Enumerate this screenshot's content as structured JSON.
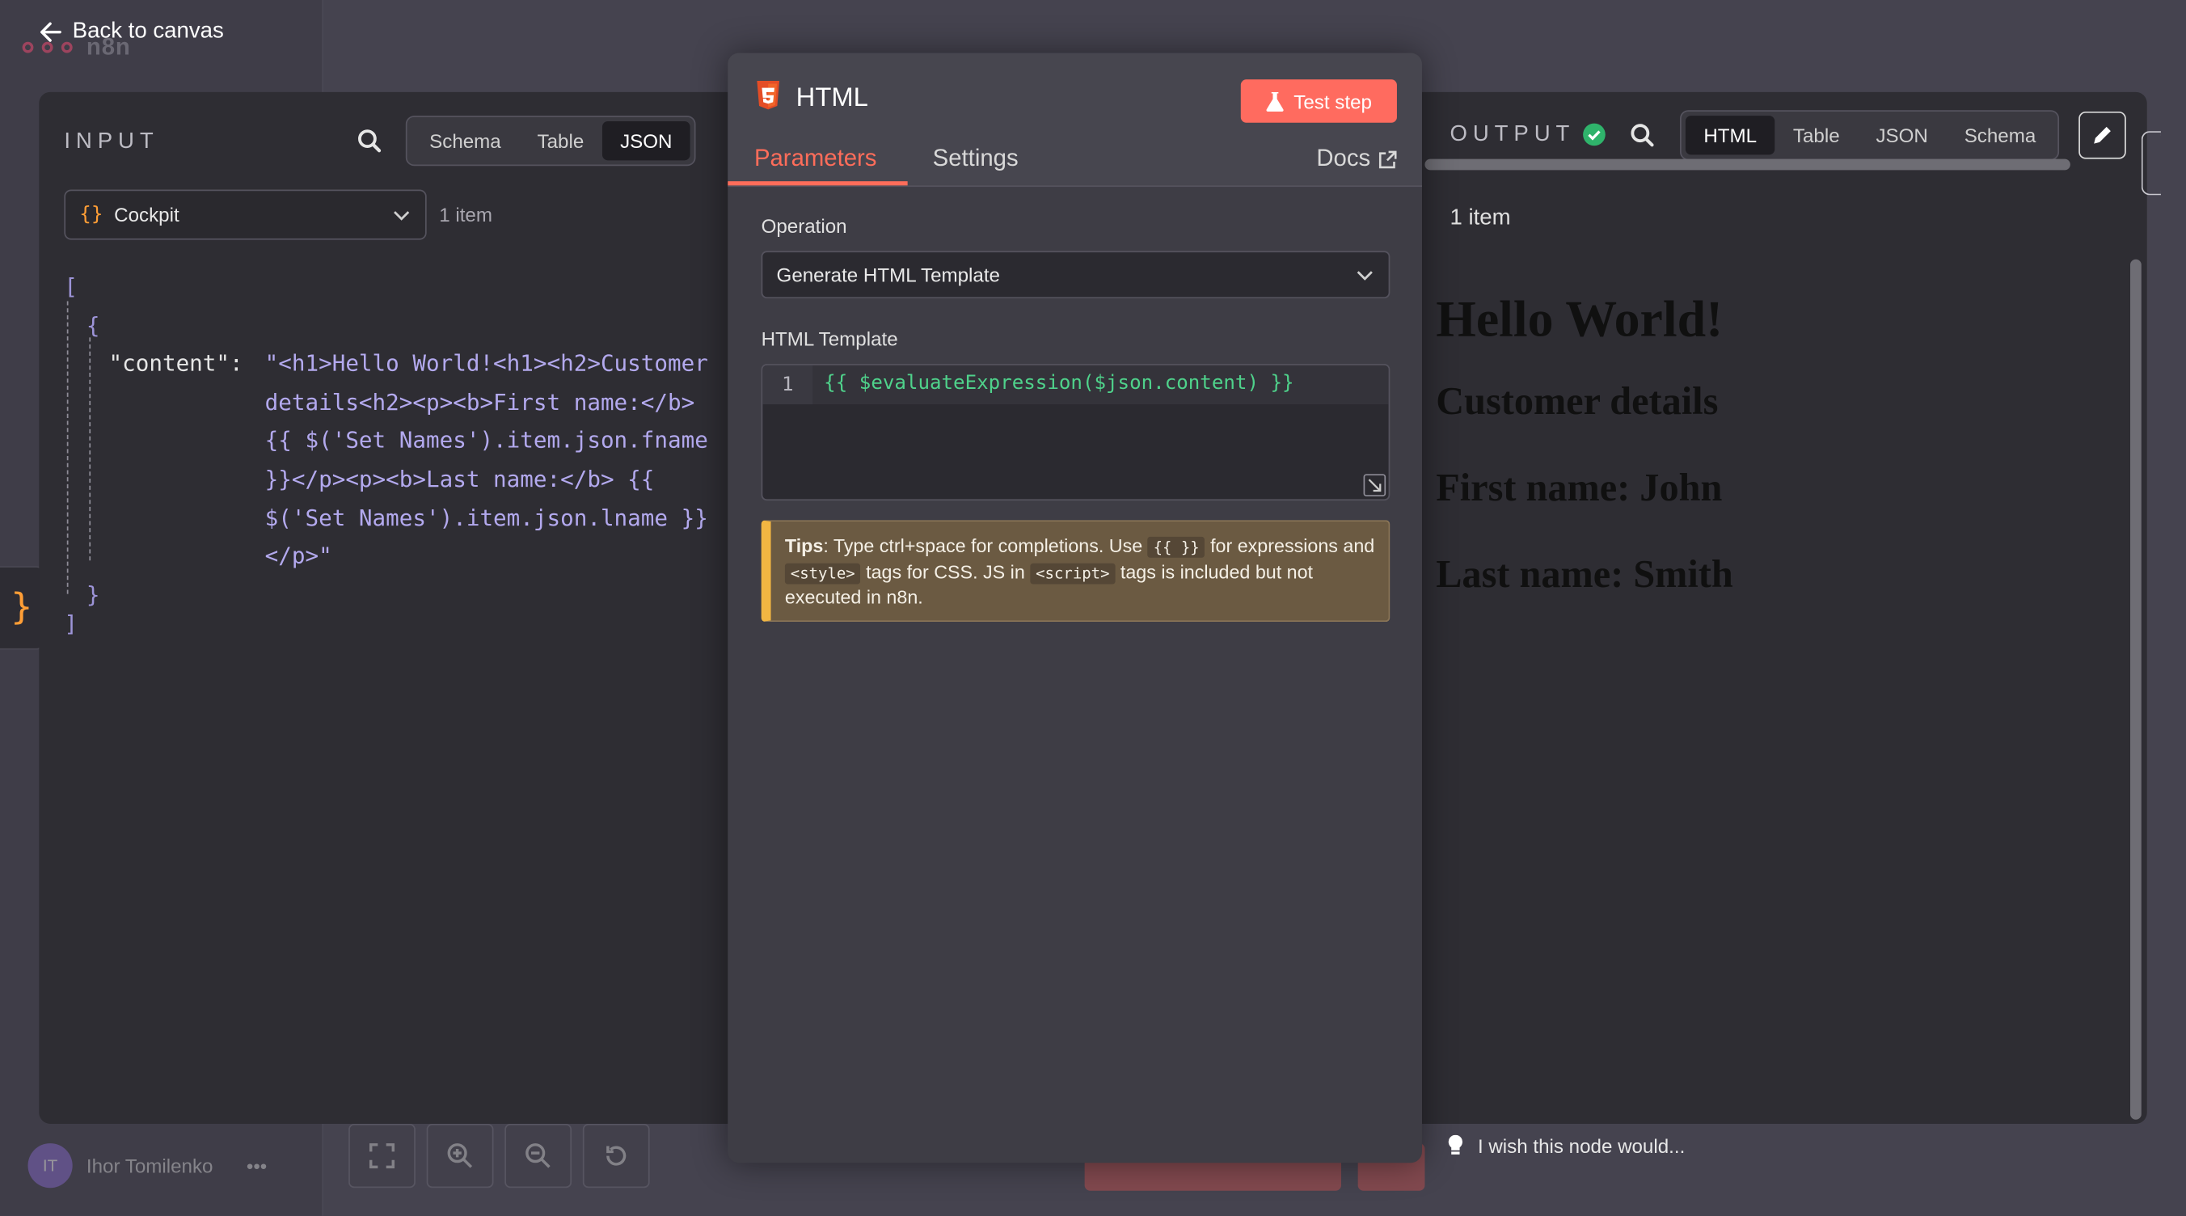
{
  "nav": {
    "back_label": "Back to canvas",
    "logo_text": "n8n"
  },
  "user": {
    "initials": "IT",
    "name": "Ihor Tomilenko",
    "more": "•••"
  },
  "input": {
    "title": "INPUT",
    "tabs": [
      "Schema",
      "Table",
      "JSON"
    ],
    "active_tab": "JSON",
    "node_select": "Cockpit",
    "item_count": "1 item",
    "json": {
      "open_bracket": "[",
      "open_brace": "{",
      "key": "\"content\":",
      "value_lines": [
        "\"<h1>Hello World!<h1><h2>Customer",
        "details<h2><p><b>First name:</b>",
        "{{ $('Set Names').item.json.fname",
        "}}</p><p><b>Last name:</b> {{",
        "$('Set Names').item.json.lname }}",
        "</p>\""
      ],
      "close_brace": "}",
      "close_bracket": "]"
    }
  },
  "params": {
    "title": "HTML",
    "test_button": "Test step",
    "tabs": {
      "parameters": "Parameters",
      "settings": "Settings",
      "docs": "Docs"
    },
    "operation_label": "Operation",
    "operation_value": "Generate HTML Template",
    "template_label": "HTML Template",
    "code_line_number": "1",
    "code_line": "{{ $evaluateExpression($json.content) }}",
    "tips": {
      "bold": "Tips",
      "t1": ": Type ctrl+space for completions. Use ",
      "c1": "{{ }}",
      "t2": " for expressions and ",
      "c2": "<style>",
      "t3": " tags for CSS. JS in ",
      "c3": "<script>",
      "t4": " tags is included but not executed in n8n."
    }
  },
  "output": {
    "title": "OUTPUT",
    "tabs": [
      "HTML",
      "Table",
      "JSON",
      "Schema"
    ],
    "active_tab": "HTML",
    "item_count": "1 item",
    "rendered": {
      "h1": "Hello World!",
      "h2": "Customer details",
      "first": "First name: John",
      "last": "Last name: Smith"
    }
  },
  "feedback": "I wish this node would...",
  "colors": {
    "accent": "#ff6d5a",
    "success": "#2fb36b",
    "json_value": "#b3a9ee",
    "code": "#4fd28b",
    "tips_border": "#f2b642"
  },
  "icons": [
    "arrow-left-icon",
    "search-icon",
    "html5-icon",
    "flask-icon",
    "external-link-icon",
    "chevron-down-icon",
    "check-circle-icon",
    "pencil-icon",
    "lightbulb-icon",
    "fit-view-icon",
    "zoom-in-icon",
    "zoom-out-icon",
    "reset-icon"
  ]
}
